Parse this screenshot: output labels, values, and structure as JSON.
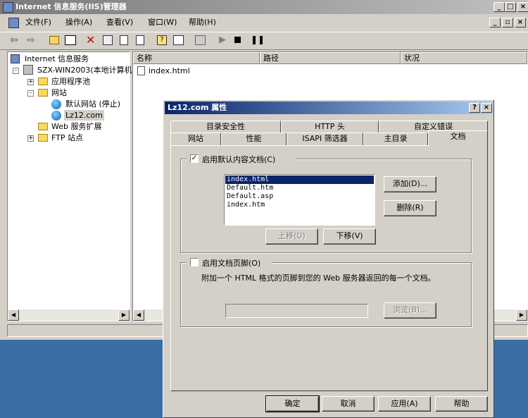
{
  "main_window": {
    "title": "Internet 信息服务(IIS)管理器",
    "menu": [
      "文件(F)",
      "操作(A)",
      "查看(V)",
      "窗口(W)",
      "帮助(H)"
    ]
  },
  "tree": {
    "root": "Internet 信息服务",
    "server": "SZX-WIN2003(本地计算机",
    "app_pools": "应用程序池",
    "websites": "网站",
    "default_site": "默认网站 (停止)",
    "lz12_site": "Lz12.com",
    "web_ext": "Web 服务扩展",
    "ftp_sites": "FTP 站点"
  },
  "list": {
    "columns": [
      "名称",
      "路径",
      "状况"
    ],
    "rows": [
      "index.html"
    ]
  },
  "dialog": {
    "title": "Lz12.com 属性",
    "tabs_back": [
      "目录安全性",
      "HTTP 头",
      "自定义错误"
    ],
    "tabs_front": [
      "网站",
      "性能",
      "ISAPI 筛选器",
      "主目录",
      "文档"
    ],
    "enable_default_doc": "启用默认内容文档(C)",
    "enable_default_doc_checked": true,
    "default_docs": [
      "index.html",
      "Default.htm",
      "Default.asp",
      "index.htm"
    ],
    "selected_doc": "index.html",
    "add_button": "添加(D)...",
    "remove_button": "删除(R)",
    "move_up_button": "上移(U)",
    "move_down_button": "下移(V)",
    "enable_footer": "启用文档页脚(O)",
    "enable_footer_checked": false,
    "footer_desc": "附加一个 HTML 格式的页脚到您的 Web 服务器返回的每一个文档。",
    "browse_button": "浏览(B)...",
    "footer_path_value": "",
    "ok_button": "确定",
    "cancel_button": "取消",
    "apply_button": "应用(A)",
    "help_button": "帮助"
  }
}
